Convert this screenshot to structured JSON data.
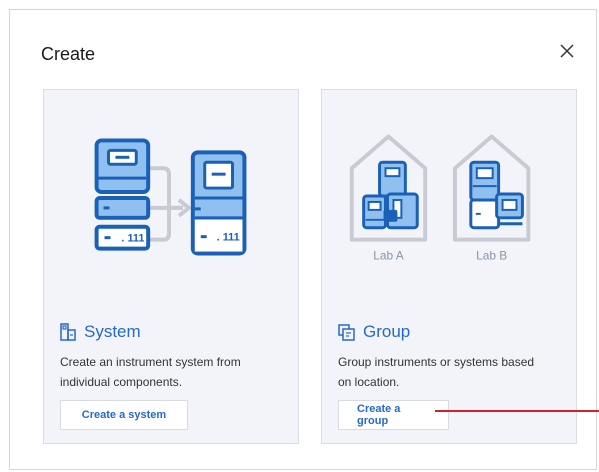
{
  "dialog": {
    "title": "Create",
    "close_icon": "close-icon"
  },
  "cards": {
    "system": {
      "title": "System",
      "icon": "system-icon",
      "description": "Create an instrument system from individual components.",
      "button_label": "Create a system"
    },
    "group": {
      "title": "Group",
      "icon": "group-icon",
      "description": "Group instruments or systems based on location.",
      "button_label": "Create a group",
      "labs": [
        "Lab A",
        "Lab B"
      ]
    }
  },
  "colors": {
    "accent": "#2769c9",
    "card_bg": "#f2f4fa",
    "illustration_fill": "#8fc0ef",
    "illustration_stroke": "#1a60b6",
    "pointer": "#d2222f"
  }
}
